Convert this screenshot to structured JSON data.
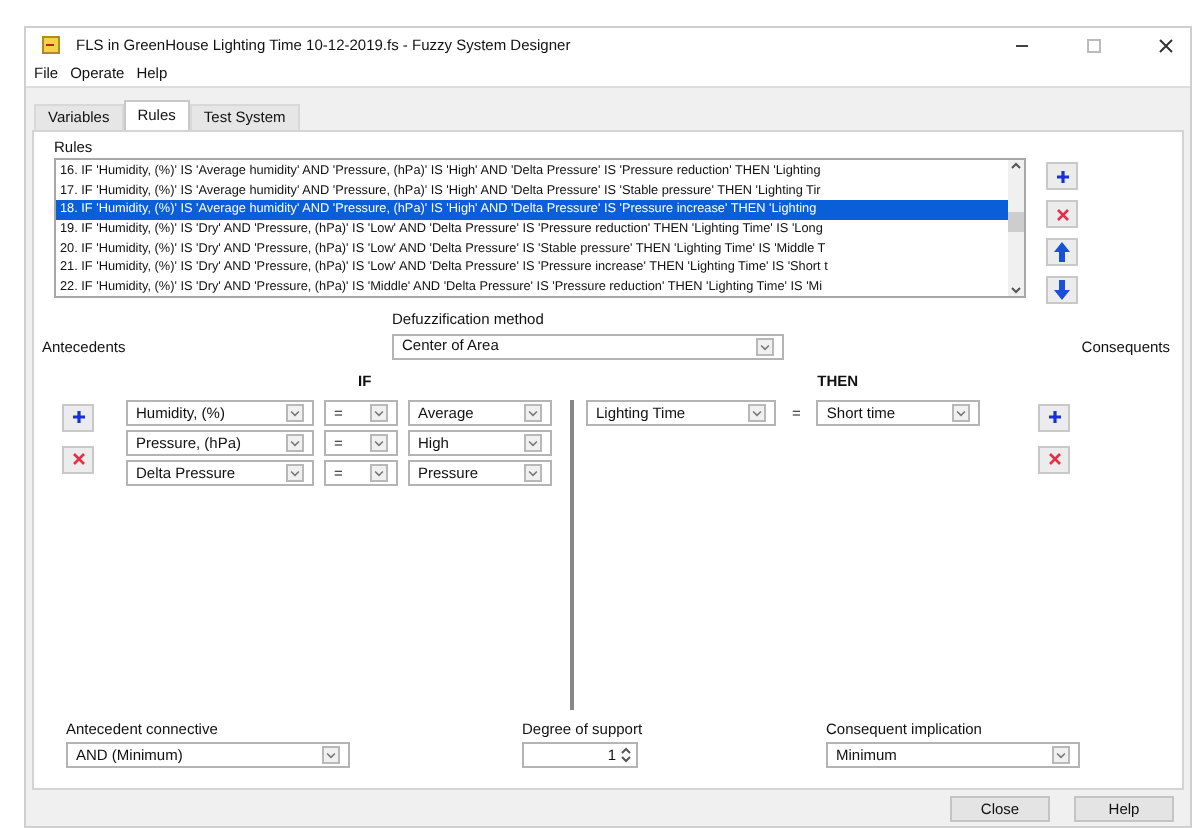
{
  "window": {
    "title": "FLS in GreenHouse Lighting Time 10-12-2019.fs - Fuzzy System Designer"
  },
  "menu": [
    "File",
    "Operate",
    "Help"
  ],
  "tabs": [
    {
      "label": "Variables",
      "selected": false
    },
    {
      "label": "Rules",
      "selected": true
    },
    {
      "label": "Test System",
      "selected": false
    }
  ],
  "rules": {
    "label": "Rules",
    "items": [
      {
        "text": "16. IF 'Humidity, (%)' IS 'Average humidity' AND 'Pressure, (hPa)' IS 'High' AND 'Delta Pressure' IS 'Pressure reduction' THEN 'Lighting",
        "selected": false
      },
      {
        "text": "17. IF 'Humidity, (%)' IS 'Average humidity' AND 'Pressure, (hPa)' IS 'High' AND 'Delta Pressure' IS 'Stable pressure' THEN 'Lighting Tir",
        "selected": false
      },
      {
        "text": "18. IF 'Humidity, (%)' IS 'Average humidity' AND 'Pressure, (hPa)' IS 'High' AND 'Delta Pressure' IS 'Pressure increase' THEN 'Lighting",
        "selected": true
      },
      {
        "text": "19. IF 'Humidity, (%)' IS 'Dry' AND 'Pressure, (hPa)' IS 'Low' AND 'Delta Pressure' IS 'Pressure reduction' THEN 'Lighting Time' IS 'Long",
        "selected": false
      },
      {
        "text": "20. IF 'Humidity, (%)' IS 'Dry' AND 'Pressure, (hPa)' IS 'Low' AND 'Delta Pressure' IS 'Stable pressure' THEN 'Lighting Time' IS 'Middle T",
        "selected": false
      },
      {
        "text": "21. IF 'Humidity, (%)' IS 'Dry' AND 'Pressure, (hPa)' IS 'Low' AND 'Delta Pressure' IS 'Pressure increase' THEN 'Lighting Time' IS 'Short t",
        "selected": false
      },
      {
        "text": "22. IF 'Humidity, (%)' IS 'Dry' AND 'Pressure, (hPa)' IS 'Middle' AND 'Delta Pressure' IS 'Pressure reduction' THEN 'Lighting Time' IS 'Mi",
        "selected": false
      }
    ]
  },
  "defuzzification": {
    "label": "Defuzzification method",
    "value": "Center of Area"
  },
  "antecedents_label": "Antecedents",
  "consequents_label": "Consequents",
  "if_label": "IF",
  "then_label": "THEN",
  "antecedents": [
    {
      "variable": "Humidity, (%)",
      "operator": "=",
      "term": "Average"
    },
    {
      "variable": "Pressure, (hPa)",
      "operator": "=",
      "term": "High"
    },
    {
      "variable": "Delta Pressure",
      "operator": "=",
      "term": "Pressure"
    }
  ],
  "consequents": [
    {
      "variable": "Lighting Time",
      "operator": "=",
      "term": "Short time"
    }
  ],
  "antecedent_connective": {
    "label": "Antecedent connective",
    "value": "AND (Minimum)"
  },
  "degree_of_support": {
    "label": "Degree of support",
    "value": "1"
  },
  "consequent_implication": {
    "label": "Consequent implication",
    "value": "Minimum"
  },
  "buttons": [
    "Close",
    "Help"
  ]
}
